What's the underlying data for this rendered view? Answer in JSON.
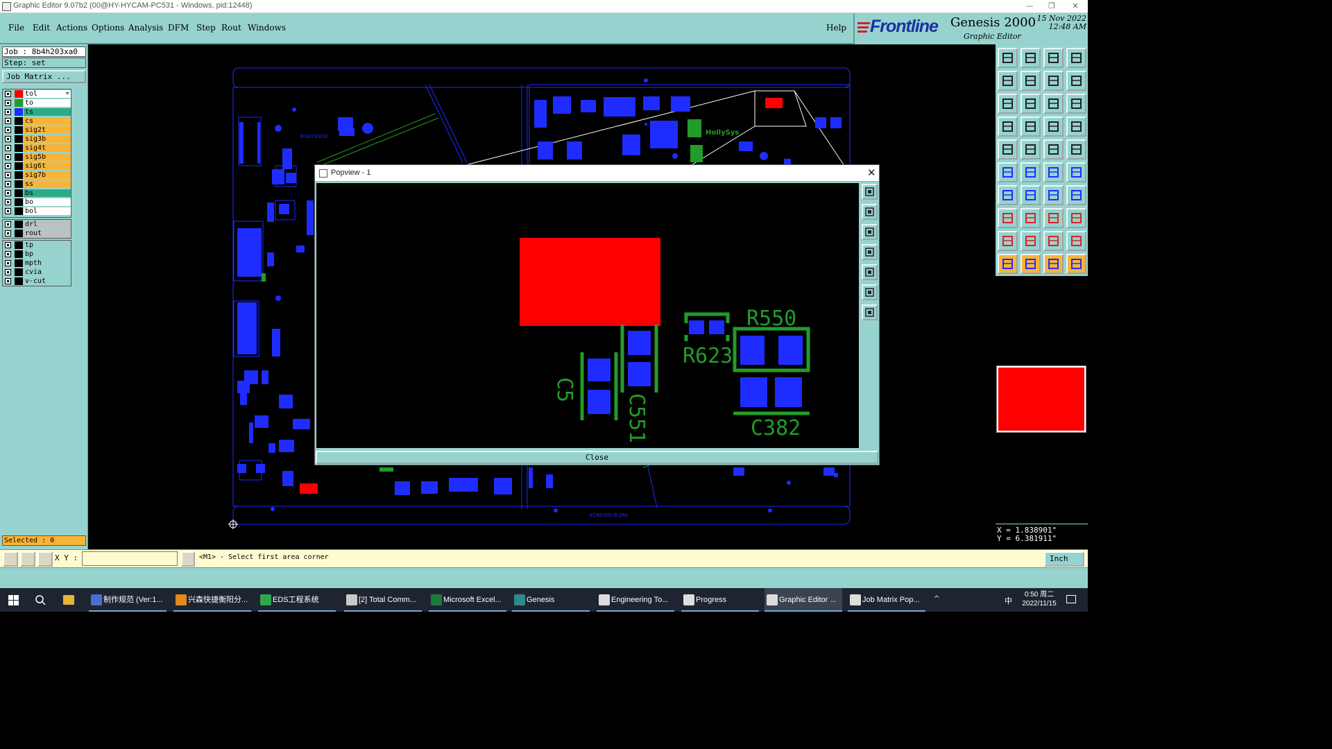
{
  "window": {
    "title": "Graphic Editor 9.07b2 (00@HY-HYCAM-PC531 - Windows, pid:12448)",
    "minimize_glyph": "—",
    "restore_glyph": "❐",
    "close_glyph": "✕"
  },
  "menu": {
    "items": [
      "File",
      "Edit",
      "Actions",
      "Options",
      "Analysis",
      "DFM",
      "Step",
      "Rout",
      "Windows"
    ],
    "help": "Help"
  },
  "brand": {
    "logo": "Frontline",
    "product": "Genesis 2000",
    "subtitle": "Graphic Editor",
    "date": "15 Nov 2022",
    "time": "12:48 AM"
  },
  "left": {
    "job": "Job : 8b4h203xa0",
    "step": "Step: set",
    "job_matrix_button": "Job Matrix ...",
    "selected": "Selected : 0"
  },
  "layers": {
    "group1": [
      {
        "name": "tol",
        "color": "#ff0000",
        "bg": "#ffffff",
        "marker": "="
      },
      {
        "name": "to",
        "color": "#229c29",
        "bg": "#ffffff",
        "marker": ""
      },
      {
        "name": "ts",
        "color": "#1f2cff",
        "bg": "#2cab88",
        "marker": ""
      },
      {
        "name": "cs",
        "color": "#000000",
        "bg": "#f9b437",
        "marker": ""
      },
      {
        "name": "sig2t",
        "color": "#000000",
        "bg": "#f9b437",
        "marker": ""
      },
      {
        "name": "sig3b",
        "color": "#000000",
        "bg": "#f9b437",
        "marker": ""
      },
      {
        "name": "sig4t",
        "color": "#000000",
        "bg": "#f9b437",
        "marker": ""
      },
      {
        "name": "sig5b",
        "color": "#000000",
        "bg": "#f9b437",
        "marker": ""
      },
      {
        "name": "sig6t",
        "color": "#000000",
        "bg": "#f9b437",
        "marker": ""
      },
      {
        "name": "sig7b",
        "color": "#000000",
        "bg": "#f9b437",
        "marker": ""
      },
      {
        "name": "ss",
        "color": "#000000",
        "bg": "#f9b437",
        "marker": ""
      },
      {
        "name": "bs",
        "color": "#000000",
        "bg": "#2cab88",
        "marker": ""
      },
      {
        "name": "bo",
        "color": "#000000",
        "bg": "#ffffff",
        "marker": ""
      },
      {
        "name": "bol",
        "color": "#000000",
        "bg": "#ffffff",
        "marker": ""
      }
    ],
    "group2": [
      {
        "name": "drl",
        "color": "#000000",
        "bg": "#c0c0c0",
        "marker": ""
      },
      {
        "name": "rout",
        "color": "#000000",
        "bg": "#c0c0c0",
        "marker": ""
      }
    ],
    "group3": [
      {
        "name": "tp",
        "color": "#000000",
        "bg": "#96d3cf",
        "marker": ""
      },
      {
        "name": "bp",
        "color": "#000000",
        "bg": "#96d3cf",
        "marker": ""
      },
      {
        "name": "mpth",
        "color": "#000000",
        "bg": "#96d3cf",
        "marker": ""
      },
      {
        "name": "cvia",
        "color": "#000000",
        "bg": "#96d3cf",
        "marker": ""
      },
      {
        "name": "v-cut",
        "color": "#000000",
        "bg": "#96d3cf",
        "marker": ""
      }
    ]
  },
  "canvas_labels": {
    "board_id_top": "ECN5305-B",
    "board_id_bottom": "ECN5305-B-2PA",
    "logo_text": "HollySys"
  },
  "popview": {
    "title": "Popview - 1",
    "close_label": "Close",
    "refdes": [
      "R550",
      "R623",
      "C5",
      "C551",
      "C382"
    ]
  },
  "coords": {
    "x": "X = 1.838901\"",
    "y": "Y = 6.381911\""
  },
  "command": {
    "xy_label": "X Y :",
    "xy_value": "",
    "prompt": "<M1> - Select first area corner",
    "units": "Inch"
  },
  "taskbar": {
    "items": [
      {
        "label": "制作规范 (Ver:1...",
        "icon_color": "#4a6fd1"
      },
      {
        "label": "兴森快捷衡阳分...",
        "icon_color": "#e08a1e"
      },
      {
        "label": "EDS工程系统",
        "icon_color": "#2ea84a"
      },
      {
        "label": "[2] Total Comm...",
        "icon_color": "#c9c9c9"
      },
      {
        "label": "Microsoft Excel...",
        "icon_color": "#1d7a3c"
      },
      {
        "label": "Genesis",
        "icon_color": "#2f8a8a"
      },
      {
        "label": "Engineering To...",
        "icon_color": "#dddddd"
      },
      {
        "label": "Progress",
        "icon_color": "#dddddd"
      },
      {
        "label": "Graphic Editor ...",
        "icon_color": "#dddddd"
      },
      {
        "label": "Job Matrix Pop...",
        "icon_color": "#dddddd"
      }
    ],
    "time": "0:50 周二",
    "date": "2022/11/15",
    "ime": "中"
  }
}
